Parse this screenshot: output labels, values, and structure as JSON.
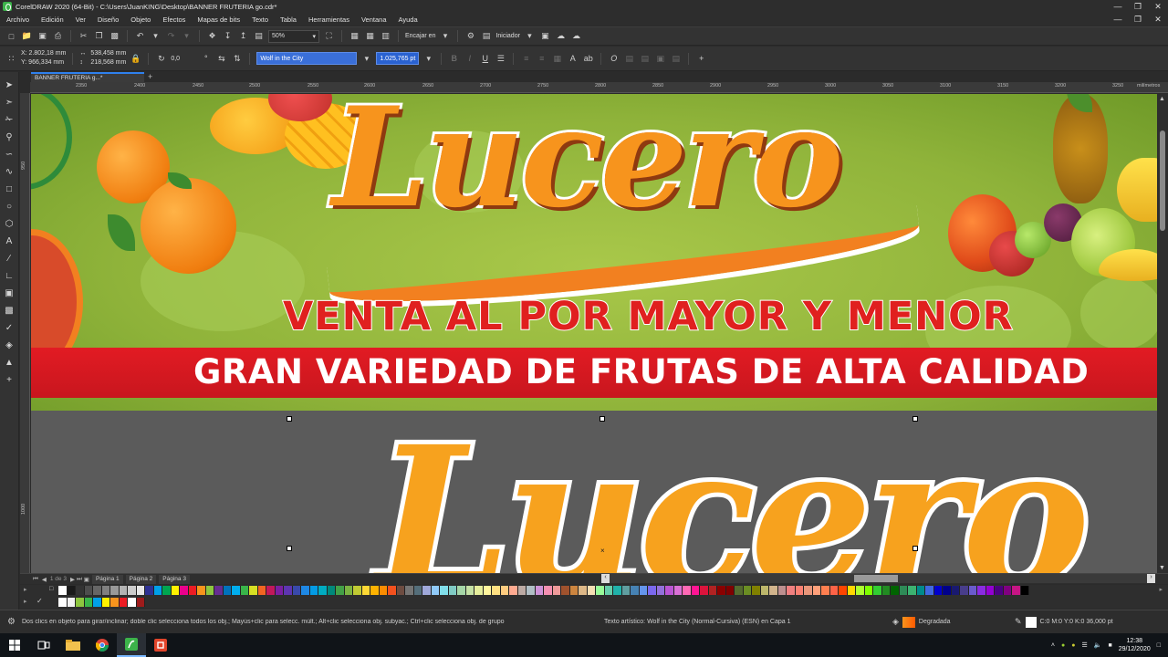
{
  "window": {
    "title": "CorelDRAW 2020 (64-Bit) - C:\\Users\\JuanKING\\Desktop\\BANNER FRUTERIA go.cdr*"
  },
  "menu": [
    "Archivo",
    "Edición",
    "Ver",
    "Diseño",
    "Objeto",
    "Efectos",
    "Mapas de bits",
    "Texto",
    "Tabla",
    "Herramientas",
    "Ventana",
    "Ayuda"
  ],
  "toolbar": {
    "zoom": "50%",
    "snap_label": "Encajar en",
    "launcher_label": "Iniciador"
  },
  "propbar": {
    "x": "X: 2.802,18 mm",
    "y": "Y: 966,334 mm",
    "w": "538,458 mm",
    "h": "218,568 mm",
    "angle": "0,0",
    "font": "Wolf in the City",
    "font_size": "1.025,765 pt"
  },
  "doc_tab": "BANNER FRUTERIA g...*",
  "ruler": {
    "unit": "milímetros",
    "h_ticks": [
      "2350",
      "2400",
      "2450",
      "2500",
      "2550",
      "2600",
      "2650",
      "2700",
      "2750",
      "2800",
      "2850",
      "2900",
      "2950",
      "3000",
      "3050",
      "3100",
      "3150",
      "3200",
      "3250"
    ],
    "v_ticks": [
      "950",
      "1000"
    ]
  },
  "banner": {
    "brand": "Lucero",
    "line1": "VENTA AL POR MAYOR Y MENOR",
    "line2": "GRAN VARIEDAD DE FRUTAS DE ALTA CALIDAD"
  },
  "logo_copy": "Lucero",
  "pages": {
    "counter": "1 de 3",
    "tabs": [
      "Página 1",
      "Página 2",
      "Página 3"
    ]
  },
  "palette": {
    "row1": [
      "#ffffff",
      "#1a1a1a",
      "#333333",
      "#4d4d4d",
      "#666666",
      "#808080",
      "#999999",
      "#b3b3b3",
      "#cccccc",
      "#e6e6e6",
      "#2e3192",
      "#00a0e9",
      "#00a651",
      "#fff200",
      "#ec008c",
      "#ed1c24",
      "#f7941d",
      "#8dc63f",
      "#662d91",
      "#0072bc",
      "#00aeef",
      "#39b54a",
      "#d7df23",
      "#f26522",
      "#c2185b",
      "#7b1fa2",
      "#5e35b1",
      "#3949ab",
      "#1e88e5",
      "#039be5",
      "#00acc1",
      "#00897b",
      "#43a047",
      "#7cb342",
      "#c0ca33",
      "#fdd835",
      "#ffb300",
      "#fb8c00",
      "#f4511e",
      "#6d4c41",
      "#757575",
      "#546e7a",
      "#9fa8da",
      "#90caf9",
      "#80deea",
      "#80cbc4",
      "#a5d6a7",
      "#c5e1a5",
      "#e6ee9c",
      "#fff59d",
      "#ffe082",
      "#ffcc80",
      "#ffab91",
      "#bcaaa4",
      "#b0bec5",
      "#ce93d8",
      "#f48fb1",
      "#ef9a9a",
      "#a0522d",
      "#cd853f",
      "#deb887",
      "#f5deb3",
      "#98fb98",
      "#66cdaa",
      "#20b2aa",
      "#5f9ea0",
      "#4682b4",
      "#6495ed",
      "#7b68ee",
      "#9370db",
      "#ba55d3",
      "#da70d6",
      "#ff69b4",
      "#ff1493",
      "#dc143c",
      "#b22222",
      "#8b0000",
      "#800000",
      "#556b2f",
      "#6b8e23",
      "#808000",
      "#bdb76b",
      "#d2b48c",
      "#bc8f8f",
      "#f08080",
      "#fa8072",
      "#e9967a",
      "#ffa07a",
      "#ff7f50",
      "#ff6347",
      "#ff4500",
      "#ffd700",
      "#adff2f",
      "#7fff00",
      "#32cd32",
      "#228b22",
      "#006400",
      "#2e8b57",
      "#3cb371",
      "#008b8b",
      "#4169e1",
      "#0000cd",
      "#00008b",
      "#191970",
      "#483d8b",
      "#6a5acd",
      "#8a2be2",
      "#9400d3",
      "#4b0082",
      "#800080",
      "#c71585",
      "#000000"
    ],
    "row2": [
      "#ffffff",
      "#f2f2f2",
      "#8dc63f",
      "#39b54a",
      "#00a0e9",
      "#fff200",
      "#f7941d",
      "#ed1c24",
      "#ffffff",
      "#9e1b1b"
    ]
  },
  "status": {
    "hint": "Dos clics en objeto para girar/inclinar; doble clic selecciona todos los obj.; Mayús+clic para selecc. múlt.; Alt+clic selecciona obj. subyac.; Ctrl+clic selecciona obj. de grupo",
    "object": "Texto artístico: Wolf in the City (Normal-Cursiva) (ESN) en Capa 1",
    "fill": "Degradada",
    "outline": "C:0 M:0 Y:0 K:0  36,000 pt"
  },
  "clock": {
    "time": "12:38",
    "date": "29/12/2020"
  },
  "colors": {
    "brand_orange": "#f7941d",
    "banner_red": "#e21b23",
    "accent_blue": "#3a6fd8"
  }
}
